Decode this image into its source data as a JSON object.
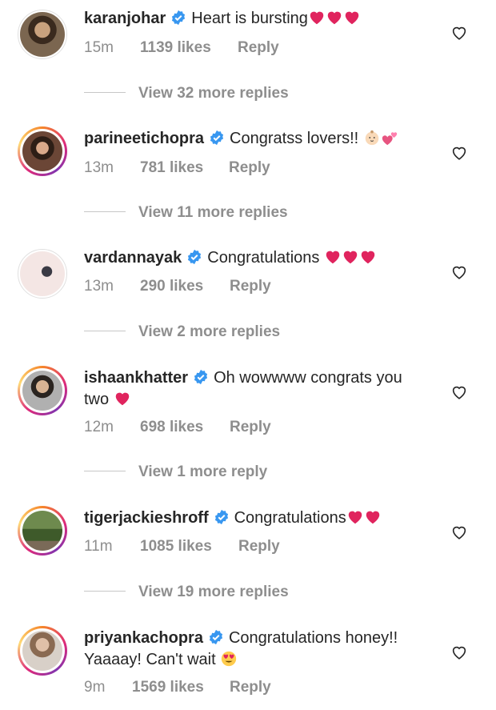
{
  "comments": [
    {
      "username": "karanjohar",
      "text": "Heart is bursting",
      "emoji": [
        "heart",
        "heart",
        "heart"
      ],
      "time": "15m",
      "likes": "1139 likes",
      "reply": "Reply",
      "view_more": "View 32 more replies",
      "avatar_color": "#6b5a48",
      "ring": false
    },
    {
      "username": "parineetichopra",
      "text": "Congratss lovers!!",
      "emoji": [
        "baby",
        "two-hearts"
      ],
      "time": "13m",
      "likes": "781 likes",
      "reply": "Reply",
      "view_more": "View 11 more replies",
      "avatar_color": "#5a3a2a",
      "ring": true
    },
    {
      "username": "vardannayak",
      "text": "Congratulations",
      "emoji": [
        "heart",
        "heart",
        "heart"
      ],
      "time": "13m",
      "likes": "290 likes",
      "reply": "Reply",
      "view_more": "View 2 more replies",
      "avatar_color": "#f4e6e4",
      "ring": false
    },
    {
      "username": "ishaankhatter",
      "text": "Oh wowwww congrats you two",
      "emoji": [
        "heart"
      ],
      "time": "12m",
      "likes": "698 likes",
      "reply": "Reply",
      "view_more": "View 1 more reply",
      "avatar_color": "#8a8a8a",
      "ring": true
    },
    {
      "username": "tigerjackieshroff",
      "text": "Congratulations",
      "emoji": [
        "heart",
        "heart"
      ],
      "time": "11m",
      "likes": "1085 likes",
      "reply": "Reply",
      "view_more": "View 19 more replies",
      "avatar_color": "#4e6b3a",
      "ring": true
    },
    {
      "username": "priyankachopra",
      "text": "Congratulations honey!! Yaaaay! Can't wait",
      "emoji": [
        "heart-eyes"
      ],
      "time": "9m",
      "likes": "1569 likes",
      "reply": "Reply",
      "view_more": "",
      "avatar_color": "#b89a86",
      "ring": true
    }
  ],
  "colors": {
    "verified": "#3897f0",
    "heart": "#e0245e",
    "meta": "#8e8e8e",
    "text": "#262626"
  }
}
